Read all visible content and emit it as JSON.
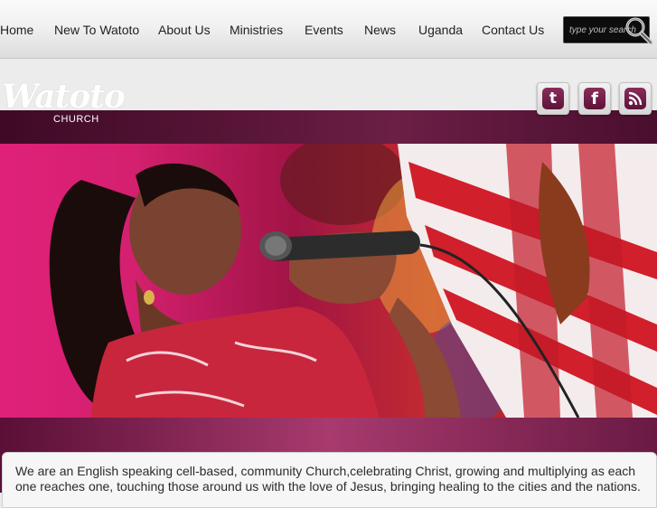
{
  "nav": {
    "items": [
      {
        "label": "Home"
      },
      {
        "label": "New To Watoto"
      },
      {
        "label": "About Us"
      },
      {
        "label": "Ministries"
      },
      {
        "label": "Events"
      },
      {
        "label": "News"
      },
      {
        "label": "Uganda"
      },
      {
        "label": "Contact Us"
      }
    ],
    "search_placeholder": "type your search"
  },
  "logo": {
    "word": "Watoto",
    "sub": "CHURCH"
  },
  "social": [
    {
      "icon": "twitter-icon",
      "glyph": "t"
    },
    {
      "icon": "facebook-icon",
      "glyph": "f"
    },
    {
      "icon": "rss-icon",
      "glyph": "rss"
    }
  ],
  "colors": {
    "brand": "#6b1f45",
    "accent": "#e0217a"
  },
  "intro": {
    "text": "We are an English speaking cell-based, community Church,celebrating Christ, growing and multiplying as each one reaches one, touching those around us with the love of Jesus, bringing healing to the cities and the nations."
  }
}
